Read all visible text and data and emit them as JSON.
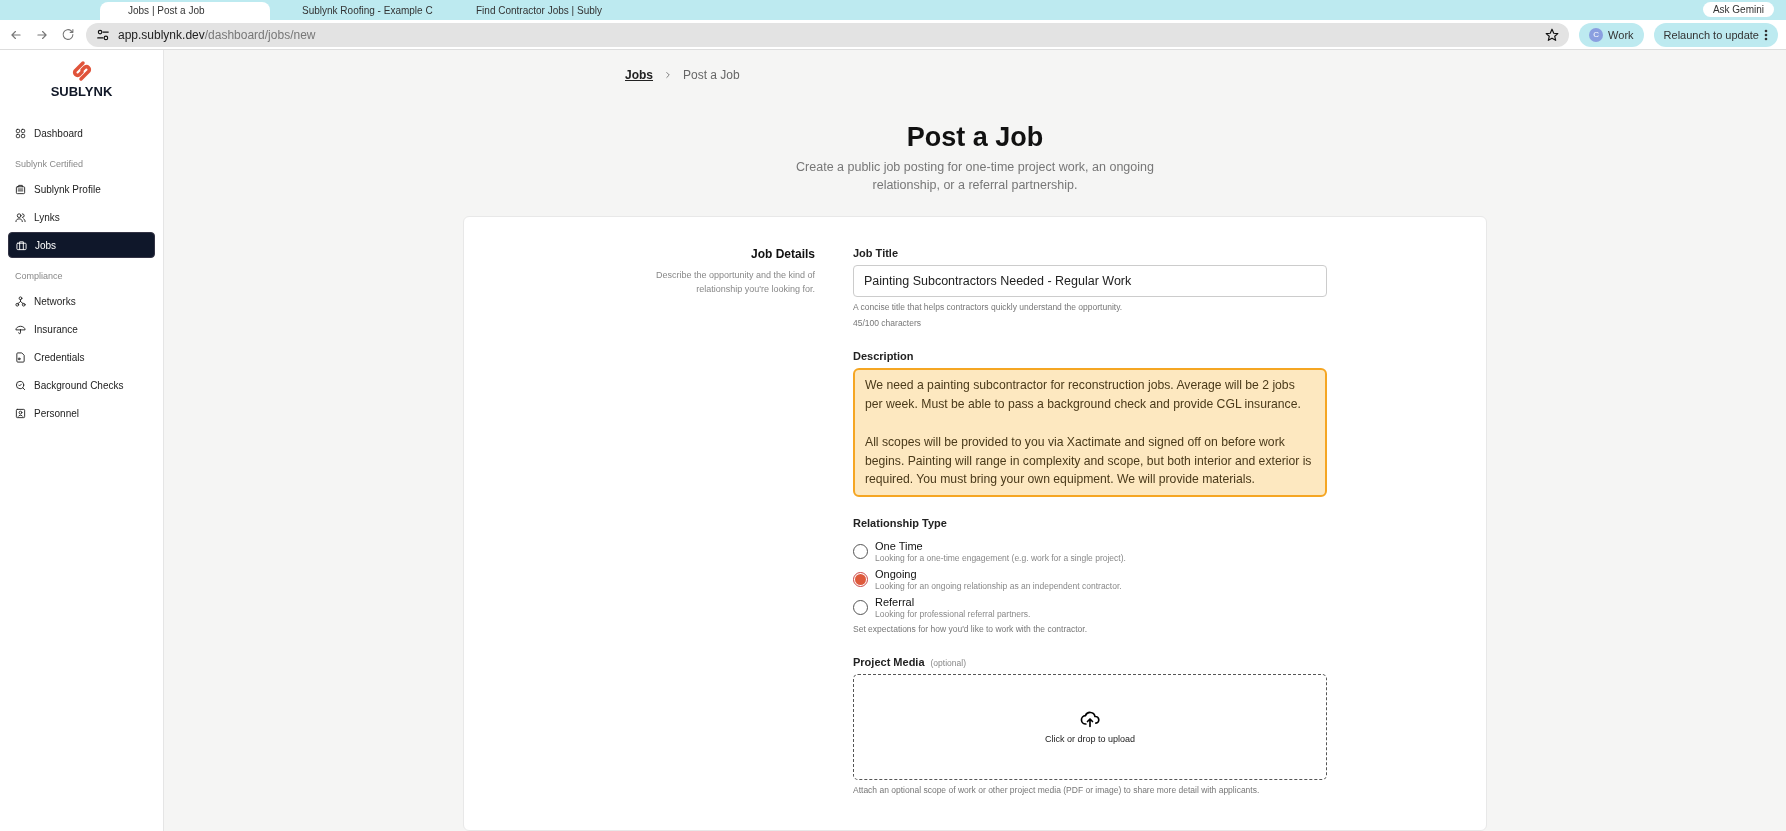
{
  "browser": {
    "tabs": [
      {
        "title": "Jobs | Post a Job",
        "selected": true
      },
      {
        "title": "Sublynk Roofing - Example C",
        "selected": false
      },
      {
        "title": "Find Contractor Jobs | Subly",
        "selected": false
      }
    ],
    "ask_button": "Ask Gemini",
    "url_host": "app.sublynk.dev",
    "url_path": "/dashboard/jobs/new",
    "profile": {
      "initial": "C",
      "label": "Work"
    },
    "relaunch_button": "Relaunch to update"
  },
  "sidebar": {
    "logo": "SUBLYNK",
    "sections": [
      {
        "items": [
          {
            "label": "Dashboard",
            "selected": false
          }
        ]
      },
      {
        "heading": "Sublynk Certified",
        "items": [
          {
            "label": "Sublynk Profile",
            "selected": false
          },
          {
            "label": "Lynks",
            "selected": false
          },
          {
            "label": "Jobs",
            "selected": true
          }
        ]
      },
      {
        "heading": "Compliance",
        "items": [
          {
            "label": "Networks",
            "selected": false
          },
          {
            "label": "Insurance",
            "selected": false
          },
          {
            "label": "Credentials",
            "selected": false
          },
          {
            "label": "Background Checks",
            "selected": false
          },
          {
            "label": "Personnel",
            "selected": false
          }
        ]
      }
    ]
  },
  "breadcrumb": [
    {
      "label": "Jobs",
      "link": true
    },
    {
      "label": "Post a Job",
      "link": false
    }
  ],
  "header": {
    "title": "Post a Job",
    "subtitle": "Create a public job posting for one-time project work, an ongoing relationship, or a referral partnership."
  },
  "section": {
    "title": "Job Details",
    "description": "Describe the opportunity and the kind of relationship you're looking for."
  },
  "job_title": {
    "label": "Job Title",
    "value": "Painting Subcontractors Needed - Regular Work",
    "hint": "A concise title that helps contractors quickly understand the opportunity.",
    "count": "45/100 characters"
  },
  "description": {
    "label": "Description",
    "highlighted": true,
    "value": "We need a painting subcontractor for reconstruction jobs. Average will be 2 jobs per week. Must be able to pass a background check and provide CGL insurance.\n\nAll scopes will be provided to you via Xactimate and signed off on before work begins. Painting will range in complexity and scope, but both interior and exterior is required. You must bring your own equipment. We will provide materials."
  },
  "relationship": {
    "label": "Relationship Type",
    "options": [
      {
        "label": "One Time",
        "description": "Looking for a one-time engagement (e.g. work for a single project).",
        "selected": false
      },
      {
        "label": "Ongoing",
        "description": "Looking for an ongoing relationship as an independent contractor.",
        "selected": true
      },
      {
        "label": "Referral",
        "description": "Looking for professional referral partners.",
        "selected": false
      }
    ],
    "hint": "Set expectations for how you'd like to work with the contractor."
  },
  "media": {
    "label": "Project Media",
    "optional": "(optional)",
    "upload_text": "Click or drop to upload",
    "hint": "Attach an optional scope of work or other project media (PDF or image) to share more detail with applicants."
  }
}
